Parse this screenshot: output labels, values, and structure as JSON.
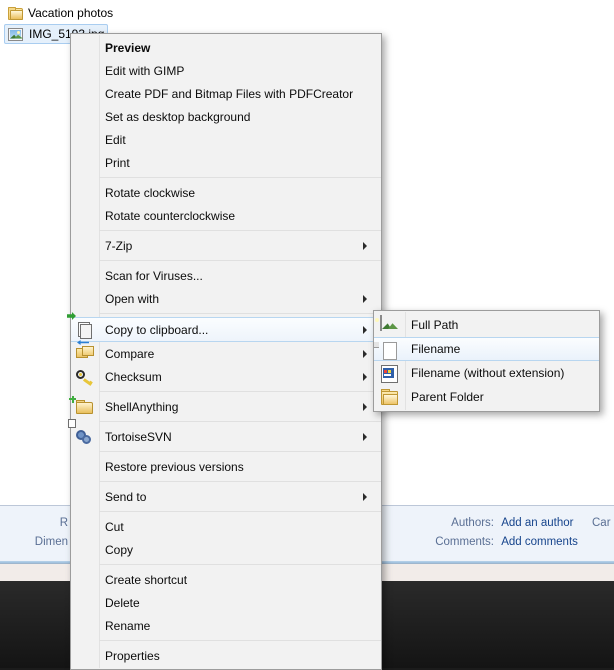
{
  "window": {
    "file_list": {
      "items": [
        {
          "name": "Vacation photos",
          "icon": "folder-icon",
          "selected": false
        },
        {
          "name": "IMG_5193.jpg",
          "icon": "picture-icon",
          "selected": true
        }
      ]
    },
    "details_pane": {
      "left_column": [
        {
          "label": "R",
          "value": ""
        },
        {
          "label": "Dimen",
          "value": ""
        }
      ],
      "middle_column": [
        {
          "label": "Authors:",
          "value": "Add an author"
        },
        {
          "label": "Comments:",
          "value": "Add comments"
        }
      ],
      "right_column": [
        {
          "label": "Car",
          "value": ""
        }
      ]
    }
  },
  "context_menu": {
    "items": [
      {
        "label": "Preview",
        "bold": true,
        "icon": null,
        "submenu": false,
        "highlighted": false
      },
      {
        "label": "Edit with GIMP",
        "bold": false,
        "icon": null,
        "submenu": false,
        "highlighted": false
      },
      {
        "label": "Create PDF and Bitmap Files with PDFCreator",
        "bold": false,
        "icon": null,
        "submenu": false,
        "highlighted": false
      },
      {
        "label": "Set as desktop background",
        "bold": false,
        "icon": null,
        "submenu": false,
        "highlighted": false
      },
      {
        "label": "Edit",
        "bold": false,
        "icon": null,
        "submenu": false,
        "highlighted": false
      },
      {
        "label": "Print",
        "bold": false,
        "icon": null,
        "submenu": false,
        "highlighted": false
      },
      {
        "separator": true
      },
      {
        "label": "Rotate clockwise",
        "bold": false,
        "icon": null,
        "submenu": false,
        "highlighted": false
      },
      {
        "label": "Rotate counterclockwise",
        "bold": false,
        "icon": null,
        "submenu": false,
        "highlighted": false
      },
      {
        "separator": true
      },
      {
        "label": "7-Zip",
        "bold": false,
        "icon": null,
        "submenu": true,
        "highlighted": false
      },
      {
        "separator": true
      },
      {
        "label": "Scan for Viruses...",
        "bold": false,
        "icon": null,
        "submenu": false,
        "highlighted": false
      },
      {
        "label": "Open with",
        "bold": false,
        "icon": null,
        "submenu": true,
        "highlighted": false
      },
      {
        "separator": true
      },
      {
        "label": "Copy to clipboard...",
        "bold": false,
        "icon": "copy-to-clipboard-icon",
        "submenu": true,
        "highlighted": true
      },
      {
        "label": "Compare",
        "bold": false,
        "icon": "compare-folders-icon",
        "submenu": true,
        "highlighted": false
      },
      {
        "label": "Checksum",
        "bold": false,
        "icon": "key-icon",
        "submenu": true,
        "highlighted": false
      },
      {
        "separator": true
      },
      {
        "label": "ShellAnything",
        "bold": false,
        "icon": "folder-plus-icon",
        "submenu": true,
        "highlighted": false
      },
      {
        "separator": true
      },
      {
        "label": "TortoiseSVN",
        "bold": false,
        "icon": "gears-icon",
        "submenu": true,
        "highlighted": false
      },
      {
        "separator": true
      },
      {
        "label": "Restore previous versions",
        "bold": false,
        "icon": null,
        "submenu": false,
        "highlighted": false
      },
      {
        "separator": true
      },
      {
        "label": "Send to",
        "bold": false,
        "icon": null,
        "submenu": true,
        "highlighted": false
      },
      {
        "separator": true
      },
      {
        "label": "Cut",
        "bold": false,
        "icon": null,
        "submenu": false,
        "highlighted": false
      },
      {
        "label": "Copy",
        "bold": false,
        "icon": null,
        "submenu": false,
        "highlighted": false
      },
      {
        "separator": true
      },
      {
        "label": "Create shortcut",
        "bold": false,
        "icon": null,
        "submenu": false,
        "highlighted": false
      },
      {
        "label": "Delete",
        "bold": false,
        "icon": null,
        "submenu": false,
        "highlighted": false
      },
      {
        "label": "Rename",
        "bold": false,
        "icon": null,
        "submenu": false,
        "highlighted": false
      },
      {
        "separator": true
      },
      {
        "label": "Properties",
        "bold": false,
        "icon": null,
        "submenu": false,
        "highlighted": false
      }
    ]
  },
  "submenu": {
    "parent": "Copy to clipboard...",
    "items": [
      {
        "label": "Full Path",
        "icon": "picture-icon",
        "highlighted": false
      },
      {
        "label": "Filename",
        "icon": "page-icon",
        "highlighted": true
      },
      {
        "label": "Filename (without extension)",
        "icon": "page-picture-icon",
        "highlighted": false
      },
      {
        "label": "Parent Folder",
        "icon": "folder-icon",
        "highlighted": false
      }
    ]
  },
  "colors": {
    "menu_background": "#f2f2f2",
    "menu_border": "#9c9c9c",
    "highlight_border": "#b8d6f0",
    "selection_background": "#e5f0fb",
    "details_background": "#eef3fa",
    "link_text": "#16448c"
  }
}
